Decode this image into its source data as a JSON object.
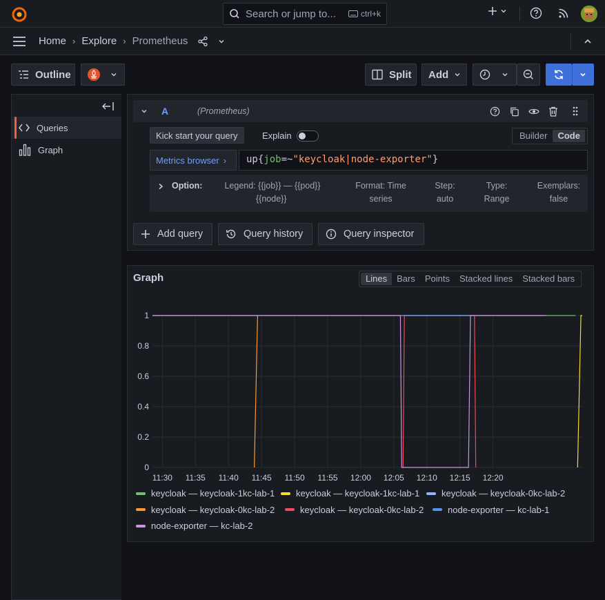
{
  "search": {
    "placeholder": "Search or jump to...",
    "shortcut": "ctrl+k"
  },
  "breadcrumb": {
    "home": "Home",
    "explore": "Explore",
    "current": "Prometheus"
  },
  "toolbar": {
    "outline": "Outline",
    "split": "Split",
    "add": "Add"
  },
  "sidebar": {
    "items": [
      {
        "label": "Queries"
      },
      {
        "label": "Graph"
      }
    ]
  },
  "query": {
    "ref": "A",
    "datasource": "(Prometheus)",
    "kickstart": "Kick start your query",
    "explain": "Explain",
    "mode_builder": "Builder",
    "mode_code": "Code",
    "metrics_browser": "Metrics browser",
    "expr_metric": "up",
    "expr_label": "job",
    "expr_op": "=~",
    "expr_value": "\"keycloak|node-exporter\"",
    "options": {
      "title": "Option:",
      "legend_line1": "Legend: {{job}} — {{pod}}",
      "legend_line2": "{{node}}",
      "format_line1": "Format: Time",
      "format_line2": "series",
      "step_line1": "Step:",
      "step_line2": "auto",
      "type_line1": "Type:",
      "type_line2": "Range",
      "exemplars_line1": "Exemplars:",
      "exemplars_line2": "false"
    },
    "add_query": "Add query",
    "query_history": "Query history",
    "query_inspector": "Query inspector"
  },
  "graph": {
    "title": "Graph",
    "styles": [
      "Lines",
      "Bars",
      "Points",
      "Stacked lines",
      "Stacked bars"
    ],
    "selected_style": "Lines"
  },
  "chart_data": {
    "type": "line",
    "x_ticks": [
      "11:30",
      "11:35",
      "11:40",
      "11:45",
      "11:50",
      "11:55",
      "12:00",
      "12:05",
      "12:10",
      "12:15",
      "12:20"
    ],
    "y_ticks": [
      "0",
      "0.2",
      "0.4",
      "0.6",
      "0.8",
      "1"
    ],
    "ylim": [
      0,
      1
    ],
    "xlim_minutes_from_1130": [
      -1.5,
      63.5
    ],
    "grid": true,
    "legend_placement": "bottom",
    "series": [
      {
        "name": "keycloak — keycloak-1kc-lab-1",
        "color": "#73bf69",
        "points": [
          [
            -1.5,
            1
          ],
          [
            62.5,
            1
          ]
        ]
      },
      {
        "name": "keycloak — keycloak-1kc-lab-1",
        "color": "#fade2a",
        "points": [
          [
            62.8,
            0
          ],
          [
            63.3,
            1
          ],
          [
            63.5,
            1
          ]
        ]
      },
      {
        "name": "keycloak — keycloak-0kc-lab-2",
        "color": "#8ab8ff",
        "points": [
          [
            36.5,
            1
          ],
          [
            46.5,
            1
          ]
        ]
      },
      {
        "name": "keycloak — keycloak-0kc-lab-2",
        "color": "#ff9830",
        "points": [
          [
            13.9,
            0
          ],
          [
            14.4,
            1
          ]
        ]
      },
      {
        "name": "keycloak — keycloak-0kc-lab-2",
        "color": "#f2495c",
        "points": [
          [
            36.4,
            0
          ],
          [
            36.6,
            1
          ],
          [
            47.2,
            1
          ],
          [
            47.4,
            0
          ]
        ]
      },
      {
        "name": "node-exporter — kc-lab-1",
        "color": "#5794f2",
        "points": [
          [
            36.3,
            1
          ],
          [
            46.8,
            1
          ]
        ]
      },
      {
        "name": "node-exporter — kc-lab-2",
        "color": "#ca95e5",
        "points": [
          [
            -1.5,
            1
          ],
          [
            36.0,
            1
          ],
          [
            36.2,
            0
          ],
          [
            46.3,
            0
          ],
          [
            46.6,
            1
          ],
          [
            58.0,
            1
          ]
        ]
      }
    ]
  }
}
